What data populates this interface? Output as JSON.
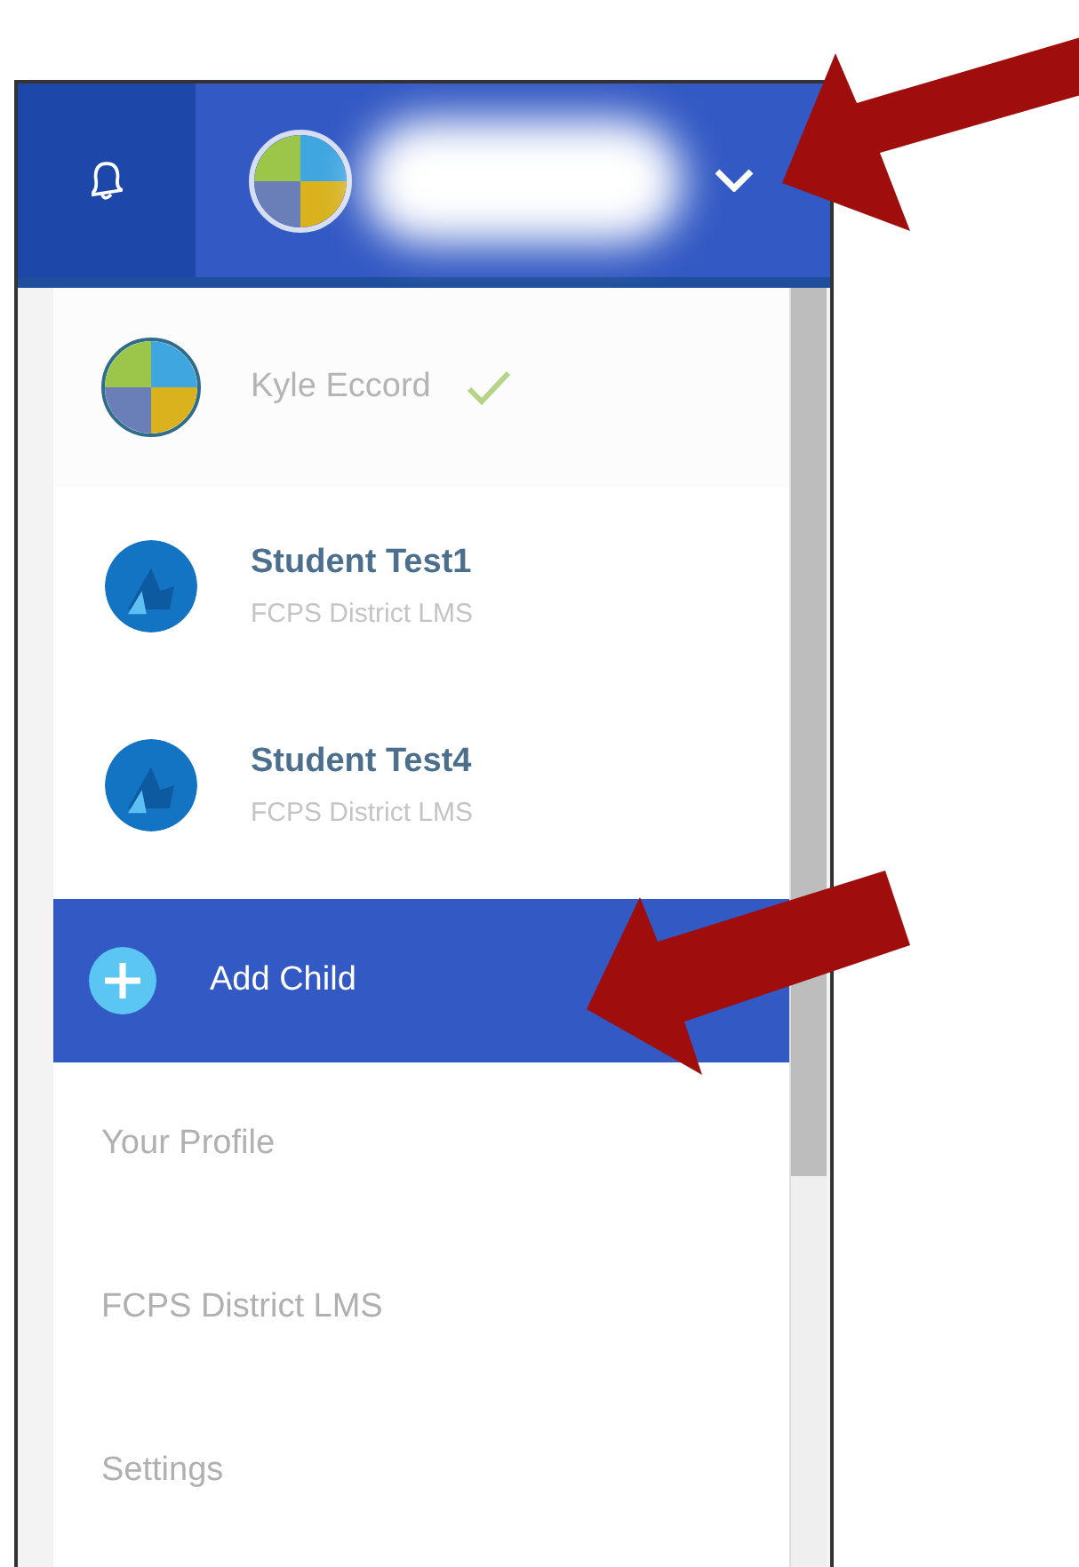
{
  "accounts": [
    {
      "name": "Kyle Eccord",
      "kind": "parent",
      "selected": true
    },
    {
      "name": "Student Test1",
      "subtitle": "FCPS District LMS",
      "kind": "student",
      "selected": false
    },
    {
      "name": "Student Test4",
      "subtitle": "FCPS District LMS",
      "kind": "student",
      "selected": false
    }
  ],
  "actions": [
    {
      "label": "Add Child",
      "kind": "add",
      "highlighted": true
    },
    {
      "label": "Your Profile",
      "kind": "link",
      "highlighted": false
    },
    {
      "label": "FCPS District LMS",
      "kind": "link",
      "highlighted": false
    },
    {
      "label": "Settings",
      "kind": "link",
      "highlighted": false
    }
  ]
}
